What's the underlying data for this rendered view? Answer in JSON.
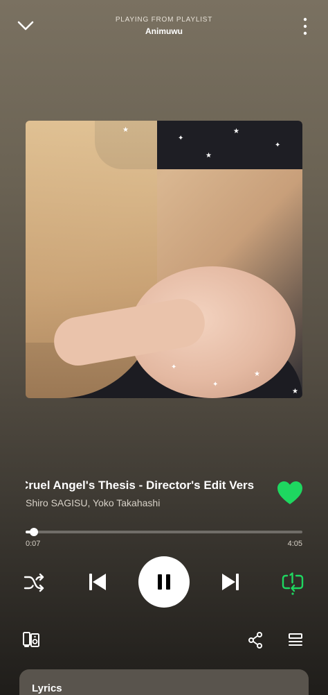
{
  "header": {
    "context_label": "PLAYING FROM PLAYLIST",
    "context_name": "Animuwu",
    "collapse_icon": "chevron-down-icon",
    "more_icon": "more-vertical-icon"
  },
  "track": {
    "title": "Cruel Angel's Thesis - Director's Edit Version",
    "artist": "Shiro SAGISU, Yoko Takahashi",
    "liked": true
  },
  "playback": {
    "elapsed": "0:07",
    "duration": "4:05",
    "progress_fraction": 0.029,
    "is_playing": true,
    "shuffle_active": false,
    "repeat_mode": "one"
  },
  "bottom_bar": {
    "devices_icon": "connect-devices-icon",
    "share_icon": "share-icon",
    "queue_icon": "queue-icon"
  },
  "lyrics": {
    "label": "Lyrics"
  },
  "colors": {
    "accent": "#1ed760",
    "bg_top": "#7a7161",
    "bg_bottom": "#1f1d1a",
    "lyrics_card": "#59544d"
  }
}
